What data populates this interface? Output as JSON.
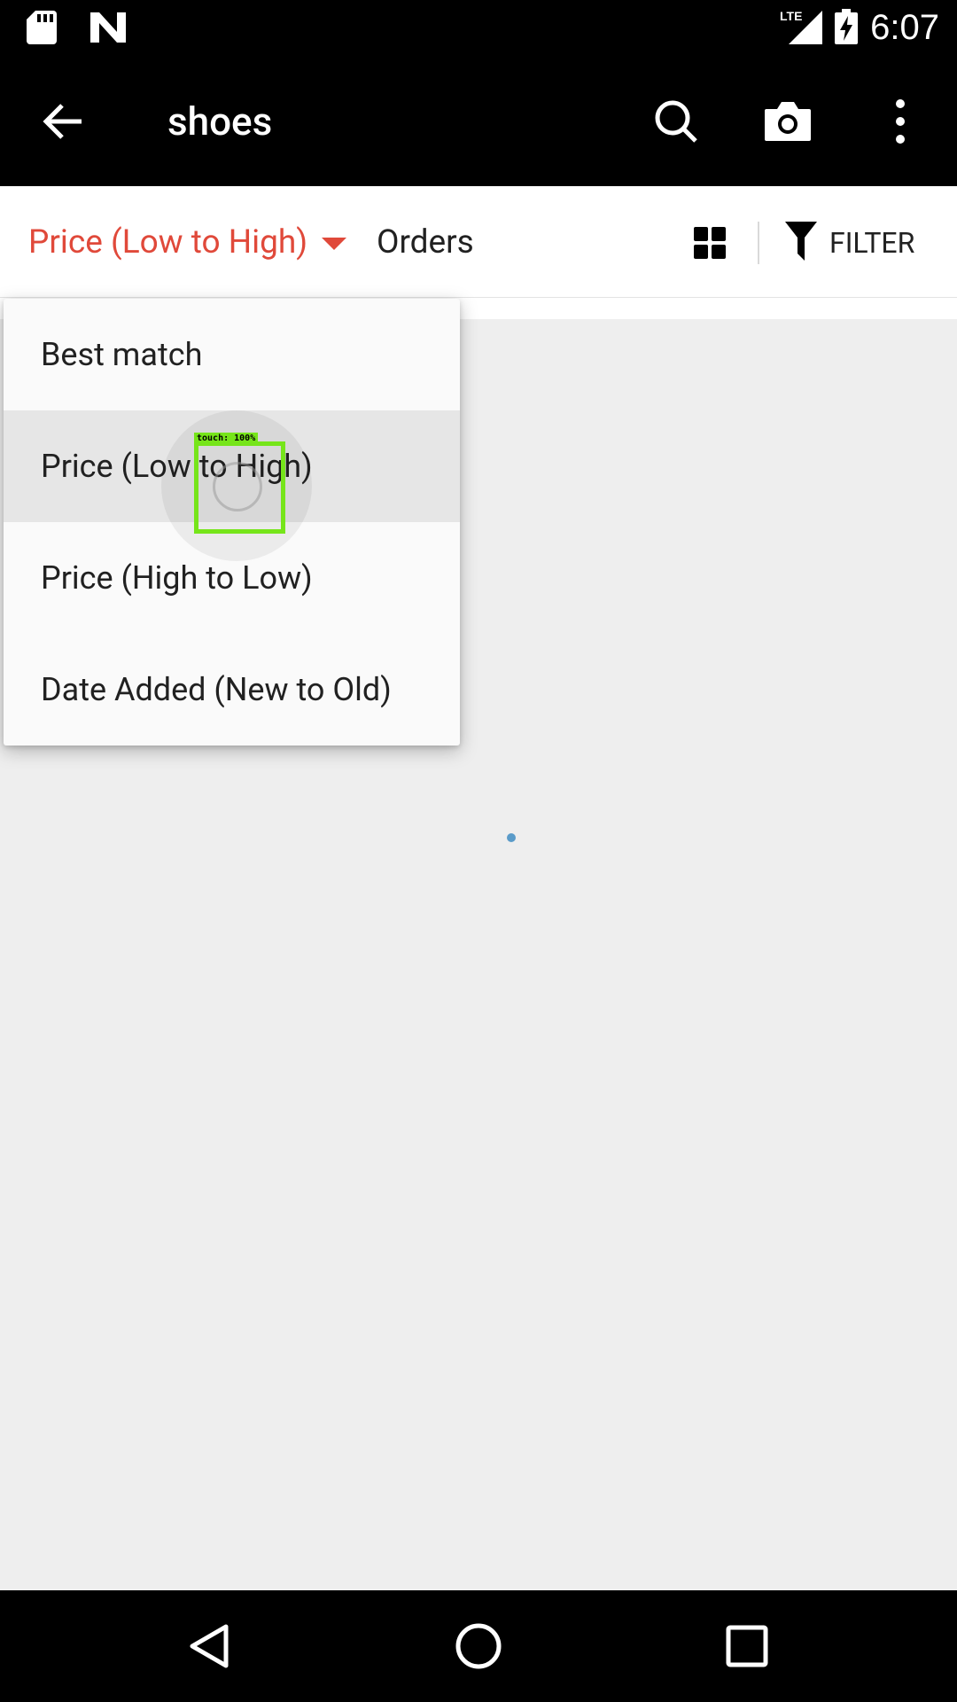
{
  "status_bar": {
    "time": "6:07",
    "network": "LTE",
    "icons": [
      "sd-card-icon",
      "n-app-icon",
      "lte-signal-icon",
      "battery-charging-icon"
    ]
  },
  "app_bar": {
    "title": "shoes",
    "icons": [
      "back-arrow-icon",
      "search-icon",
      "camera-icon",
      "more-vert-icon"
    ]
  },
  "sort_bar": {
    "selected_sort": "Price (Low to High)",
    "orders_label": "Orders",
    "filter_label": "FILTER",
    "accent_color": "#e0493a"
  },
  "dropdown": {
    "items": [
      {
        "label": "Best match",
        "selected": false
      },
      {
        "label": "Price (Low to High)",
        "selected": true
      },
      {
        "label": "Price (High to Low)",
        "selected": false
      },
      {
        "label": "Date Added (New to Old)",
        "selected": false
      }
    ]
  },
  "touch_overlay": {
    "label": "touch: 100%",
    "color": "#76e51a"
  },
  "nav_bar": {
    "icons": [
      "nav-back-icon",
      "nav-home-icon",
      "nav-recents-icon"
    ]
  }
}
